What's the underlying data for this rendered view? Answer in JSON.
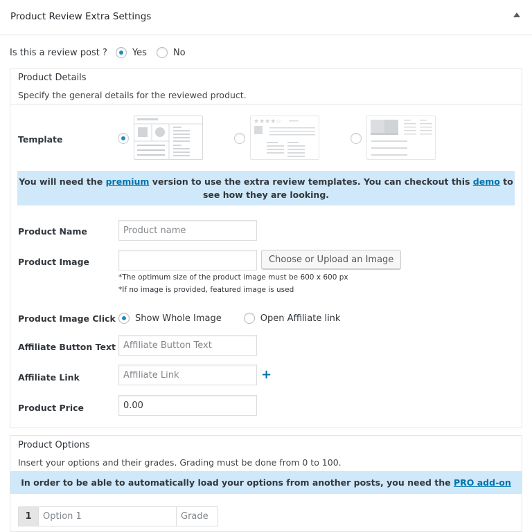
{
  "metabox": {
    "title": "Product Review Extra Settings",
    "toggle_icon": "triangle-up-icon"
  },
  "review_toggle": {
    "question": "Is this a review post ?",
    "options": [
      {
        "label": "Yes",
        "checked": true
      },
      {
        "label": "No",
        "checked": false
      }
    ]
  },
  "product_details": {
    "title": "Product Details",
    "description": "Specify the general details for the reviewed product.",
    "template": {
      "label": "Template",
      "options": [
        {
          "name": "default-template",
          "checked": true,
          "enabled": true
        },
        {
          "name": "stars-template",
          "checked": false,
          "enabled": false
        },
        {
          "name": "banner-template",
          "checked": false,
          "enabled": false
        }
      ]
    },
    "premium_notice": {
      "text_before": "You will need the ",
      "link1": "premium",
      "text_middle": " version to use the extra review templates. You can checkout this ",
      "link2": "demo",
      "text_after": " to see how they are looking."
    },
    "product_name": {
      "label": "Product Name",
      "value": "",
      "placeholder": "Product name"
    },
    "product_image": {
      "label": "Product Image",
      "value": "",
      "button": "Choose or Upload an Image",
      "hint1": "*The optimum size of the product image must be 600 x 600 px",
      "hint2": "*If no image is provided, featured image is used"
    },
    "image_click": {
      "label": "Product Image Click :",
      "options": [
        {
          "label": "Show Whole Image",
          "checked": true
        },
        {
          "label": "Open Affiliate link",
          "checked": false
        }
      ]
    },
    "affiliate_button_text": {
      "label": "Affiliate Button Text",
      "value": "",
      "placeholder": "Affiliate Button Text"
    },
    "affiliate_link": {
      "label": "Affiliate Link",
      "value": "",
      "placeholder": "Affiliate Link",
      "add_icon": "plus-icon",
      "add_symbol": "+"
    },
    "product_price": {
      "label": "Product Price",
      "value": "0.00"
    }
  },
  "product_options": {
    "title": "Product Options",
    "description": "Insert your options and their grades. Grading must be done from 0 to 100.",
    "pro_notice": {
      "text": "In order to be able to automatically load your options from another posts, you need the ",
      "link": "PRO add-on"
    },
    "rows": [
      {
        "number": "1",
        "option_placeholder": "Option 1",
        "grade_placeholder": "Grade"
      }
    ]
  },
  "colors": {
    "accent": "#1e8cbe",
    "link": "#0073aa",
    "notice_bg": "#cfe8fa"
  }
}
